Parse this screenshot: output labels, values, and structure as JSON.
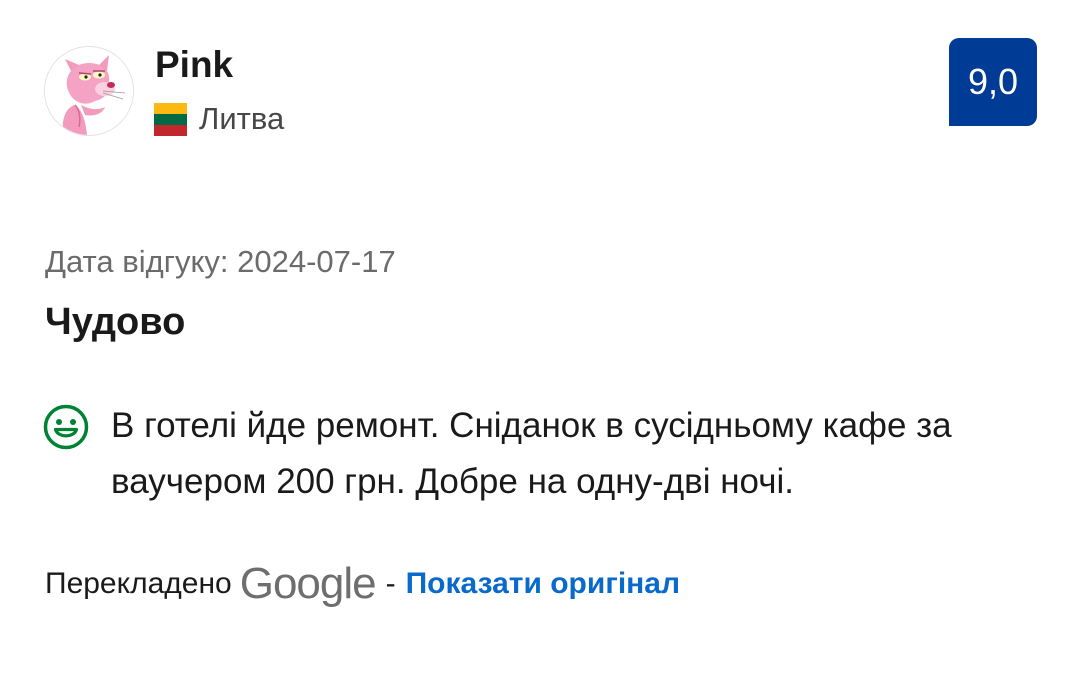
{
  "reviewer": {
    "name": "Pink",
    "country": "Литва"
  },
  "score": {
    "value": "9,0",
    "color": "#003b95"
  },
  "review": {
    "date_text": "Дата відгуку: 2024-07-17",
    "title": "Чудово",
    "positive_text": "В готелі йде ремонт. Сніданок в сусідньому кафе за ваучером 200 грн. Добре на одну-дві ночі.",
    "positive_icon": "smile-icon",
    "positive_color": "#008234"
  },
  "translation": {
    "label": "Перекладено",
    "provider": "Google",
    "separator": "-",
    "show_original": "Показати оригінал",
    "link_color": "#0a6acc"
  },
  "icons": {
    "avatar": "pink-panther-avatar",
    "flag": "lithuania-flag-icon"
  }
}
